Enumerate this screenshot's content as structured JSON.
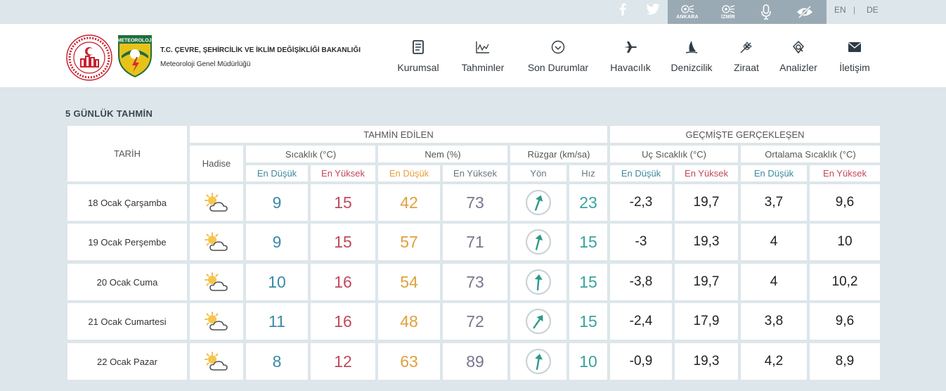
{
  "topbar": {
    "social": [
      "facebook-icon",
      "twitter-icon"
    ],
    "cities": [
      {
        "label": "ANKARA",
        "icon": "radar-icon"
      },
      {
        "label": "İZMİR",
        "icon": "radar-icon"
      }
    ],
    "tools": [
      "microphone-icon",
      "eye-slash-icon"
    ],
    "lang_en": "EN",
    "lang_sep": "|",
    "lang_de": "DE"
  },
  "header": {
    "org_line1": "T.C. ÇEVRE, ŞEHİRCİLİK VE İKLİM DEĞİŞİKLİĞİ BAKANLIĞI",
    "org_line2": "Meteoroloji Genel Müdürlüğü",
    "logo_text": "METEOROLOJİ",
    "nav": [
      {
        "label": "Kurumsal",
        "icon": "document-icon"
      },
      {
        "label": "Tahminler",
        "icon": "chart-icon"
      },
      {
        "label": "Son Durumlar",
        "icon": "check-circle-icon"
      },
      {
        "label": "Havacılık",
        "icon": "plane-icon"
      },
      {
        "label": "Denizcilik",
        "icon": "sail-icon"
      },
      {
        "label": "Ziraat",
        "icon": "wheat-icon"
      },
      {
        "label": "Analizler",
        "icon": "analysis-icon"
      },
      {
        "label": "İletişim",
        "icon": "envelope-icon"
      }
    ]
  },
  "forecast": {
    "title": "5 GÜNLÜK TAHMİN",
    "col_date": "TARİH",
    "group_forecast": "TAHMİN EDİLEN",
    "group_history": "GEÇMİŞTE GERÇEKLEŞEN",
    "col_event": "Hadise",
    "col_temp": "Sıcaklık (°C)",
    "col_hum": "Nem (%)",
    "col_wind": "Rüzgar (km/sa)",
    "col_extreme": "Uç Sıcaklık (°C)",
    "col_avg": "Ortalama Sıcaklık (°C)",
    "sub_min": "En Düşük",
    "sub_max": "En Yüksek",
    "sub_dir": "Yön",
    "sub_speed": "Hız",
    "event_icon": "partly-cloudy-icon",
    "rows": [
      {
        "date": "18 Ocak Çarşamba",
        "tmin": "9",
        "tmax": "15",
        "hmin": "42",
        "hmax": "73",
        "wind_dir_deg": 20,
        "speed": "23",
        "xmin": "-2,3",
        "xmax": "19,7",
        "amin": "3,7",
        "amax": "9,6"
      },
      {
        "date": "19 Ocak Perşembe",
        "tmin": "9",
        "tmax": "15",
        "hmin": "57",
        "hmax": "71",
        "wind_dir_deg": 15,
        "speed": "15",
        "xmin": "-3",
        "xmax": "19,3",
        "amin": "4",
        "amax": "10"
      },
      {
        "date": "20 Ocak Cuma",
        "tmin": "10",
        "tmax": "16",
        "hmin": "54",
        "hmax": "73",
        "wind_dir_deg": 5,
        "speed": "15",
        "xmin": "-3,8",
        "xmax": "19,7",
        "amin": "4",
        "amax": "10,2"
      },
      {
        "date": "21 Ocak Cumartesi",
        "tmin": "11",
        "tmax": "16",
        "hmin": "48",
        "hmax": "72",
        "wind_dir_deg": 35,
        "speed": "15",
        "xmin": "-2,4",
        "xmax": "17,9",
        "amin": "3,8",
        "amax": "9,6"
      },
      {
        "date": "22 Ocak Pazar",
        "tmin": "8",
        "tmax": "12",
        "hmin": "63",
        "hmax": "89",
        "wind_dir_deg": 10,
        "speed": "10",
        "xmin": "-0,9",
        "xmax": "19,3",
        "amin": "4,2",
        "amax": "8,9"
      }
    ]
  }
}
